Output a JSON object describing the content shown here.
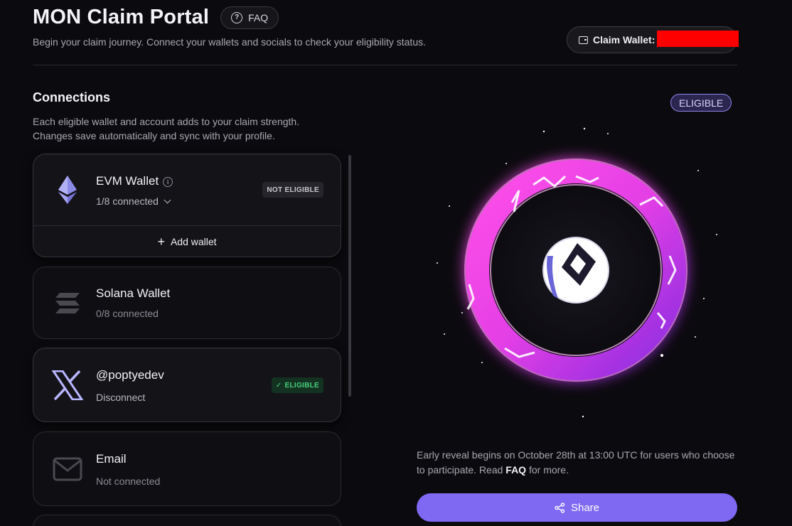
{
  "header": {
    "title": "MON Claim Portal",
    "faq_label": "FAQ",
    "subtitle": "Begin your claim journey. Connect your wallets and socials to check your eligibility status.",
    "claim_wallet_label": "Claim Wallet:"
  },
  "connections": {
    "title": "Connections",
    "desc_line1": "Each eligible wallet and account adds to your claim strength.",
    "desc_line2": "Changes save automatically and sync with your profile.",
    "cards": [
      {
        "name": "EVM Wallet",
        "status": "1/8 connected",
        "badge": "NOT ELIGIBLE",
        "action": "Add wallet",
        "icon": "ethereum-icon"
      },
      {
        "name": "Solana Wallet",
        "status": "0/8 connected",
        "icon": "solana-icon"
      },
      {
        "name": "@poptyedev",
        "status": "Disconnect",
        "badge": "ELIGIBLE",
        "icon": "x-logo-icon"
      },
      {
        "name": "Email",
        "status": "Not connected",
        "icon": "mail-icon"
      }
    ]
  },
  "status": {
    "eligible_label": "ELIGIBLE",
    "reveal_text_1": "Early reveal begins on October 28th at 13:00 UTC for users who choose to participate. Read",
    "reveal_link": "FAQ",
    "reveal_text_2": "for more.",
    "share_label": "Share"
  },
  "colors": {
    "accent": "#7f68f2",
    "ring": "#e041e8",
    "eligible_green": "#47d17c",
    "background": "#0b0a0e"
  }
}
